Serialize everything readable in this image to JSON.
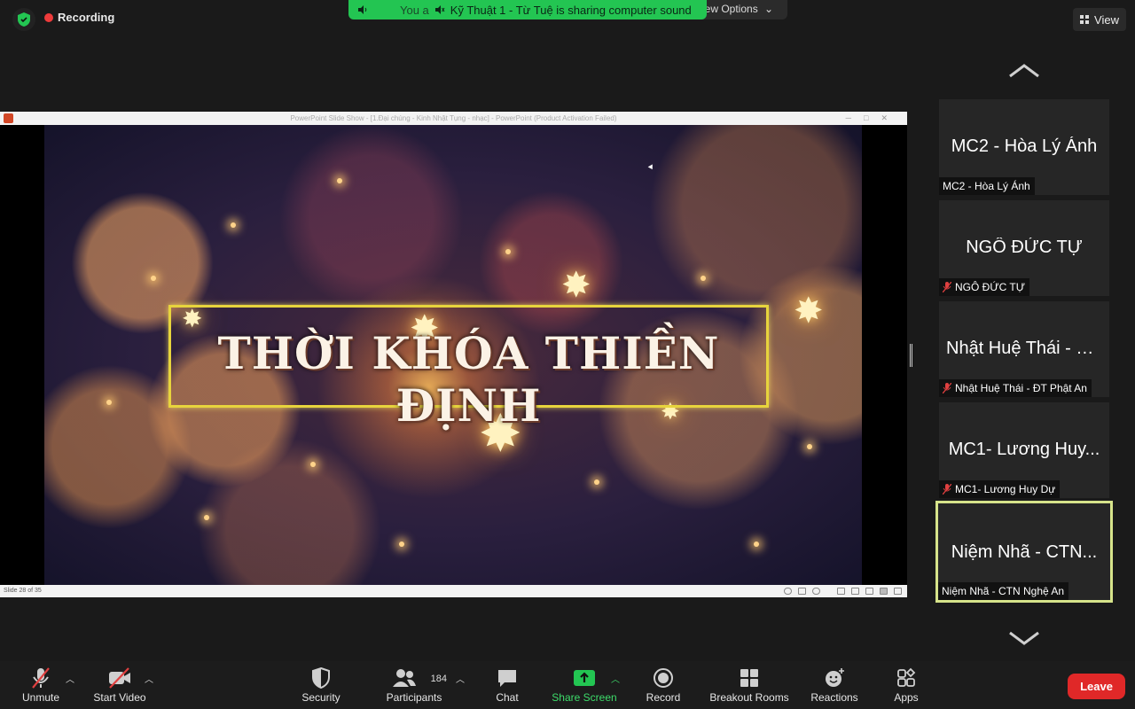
{
  "top": {
    "recording_label": "Recording",
    "view_options_label": "iew Options",
    "banner_prefix": "You a",
    "banner_text": "Kỹ Thuật 1  - Từ Tuệ is sharing computer sound",
    "view_label": "View"
  },
  "share": {
    "window_title": "PowerPoint Slide Show - [1.Đại chúng - Kinh Nhật Tụng - nhạc] - PowerPoint (Product Activation Failed)",
    "slide_title": "THỜI KHÓA THIỀN ĐỊNH",
    "slide_counter": "Slide 28 of 35"
  },
  "gallery": [
    {
      "name": "MC2 - Hòa Lý Ánh",
      "label": "MC2 - Hòa Lý Ánh",
      "muted": false,
      "active": false
    },
    {
      "name": "NGÔ ĐỨC TỰ",
      "label": "NGÔ ĐỨC TỰ",
      "muted": true,
      "active": false
    },
    {
      "name": "Nhật Huệ Thái - Đ...",
      "label": "Nhật Huệ Thái - ĐT Phật An",
      "muted": true,
      "active": false
    },
    {
      "name": "MC1- Lương Huy...",
      "label": "MC1- Lương Huy Dự",
      "muted": true,
      "active": false
    },
    {
      "name": "Niệm Nhã - CTN...",
      "label": "Niệm Nhã - CTN Nghệ An",
      "muted": false,
      "active": true
    }
  ],
  "toolbar": {
    "unmute": "Unmute",
    "start_video": "Start Video",
    "security": "Security",
    "participants": "Participants",
    "participant_count": "184",
    "chat": "Chat",
    "share_screen": "Share Screen",
    "record": "Record",
    "breakout_rooms": "Breakout Rooms",
    "reactions": "Reactions",
    "apps": "Apps",
    "leave": "Leave"
  },
  "colors": {
    "share_green": "#23c552",
    "leave_red": "#e02828",
    "active_speaker": "#d6e38a",
    "muted_red": "#e04040"
  }
}
